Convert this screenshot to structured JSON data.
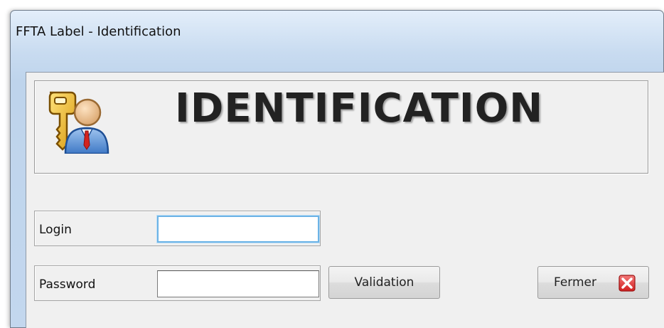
{
  "window": {
    "title": "FFTA Label - Identification"
  },
  "header": {
    "heading": "IDENTIFICATION",
    "icon": "user-key-icon"
  },
  "form": {
    "login_label": "Login",
    "login_value": "",
    "password_label": "Password",
    "password_value": ""
  },
  "buttons": {
    "validation_label": "Validation",
    "close_label": "Fermer",
    "close_icon": "close-icon"
  },
  "colors": {
    "title_bar": "#c8dbf0",
    "client_bg": "#f0f0f0",
    "focus_border": "#6cb3e6",
    "close_icon_red": "#e23a3a"
  }
}
